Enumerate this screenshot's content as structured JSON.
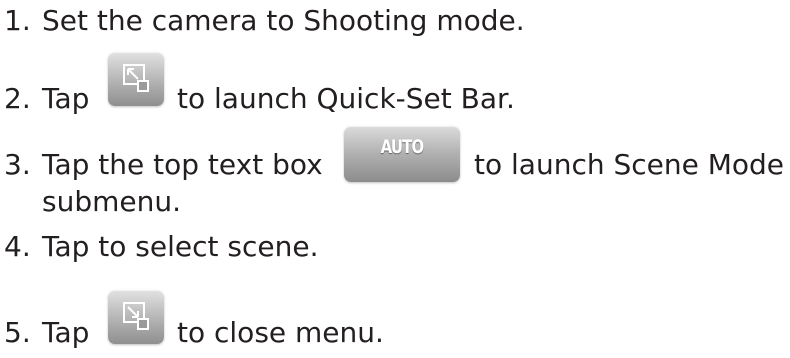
{
  "steps": [
    {
      "number": "1.",
      "text": "Set the camera to Shooting mode."
    },
    {
      "number": "2.",
      "before": "Tap",
      "after": "to launch Quick-Set Bar."
    },
    {
      "number": "3.",
      "before": "Tap the top text box",
      "after": "to launch Scene Mode",
      "continuation": "submenu."
    },
    {
      "number": "4.",
      "text": "Tap to select scene."
    },
    {
      "number": "5.",
      "before": "Tap",
      "after": "to close menu."
    }
  ],
  "icons": {
    "open_quick_set": "quick-set-open-icon",
    "close_menu": "quick-set-close-icon"
  },
  "auto_button": {
    "label": "AUTO"
  },
  "colors": {
    "text": "#231f20",
    "button_top": "#e2e2e2",
    "button_bottom": "#8f8f8f",
    "button_label": "#ffffff"
  }
}
